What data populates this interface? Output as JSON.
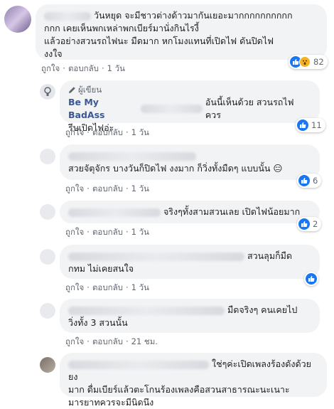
{
  "actions": {
    "like": "ถูกใจ",
    "dot": "·",
    "reply": "ตอบกลับ"
  },
  "comments": [
    {
      "text_lines": [
        "วันหยุด จะมีชาวต่างด้าวมากันเยอะมากกกกกกกกกก",
        "กกก เคยเห็นพกเหล่าพกเบียร์มานั่งกินไรงี้",
        "แล้วอย่างสวนรถไฟนะ มืดมาก หกโมงแทนที่เปิดไฟ ดันปิดไฟ",
        "งงใจ"
      ],
      "time": "1 วัน",
      "reaction_count": "82",
      "reactions": [
        "like-icon",
        "wow-icon"
      ]
    },
    {
      "author_tag": "ผู้เขียน",
      "author_name": "Be My BadAss",
      "text_lines": [
        "อันนี้เห็นด้วย สวนรถไฟ ควร",
        "รีบเปิดไฟอ่ะ"
      ],
      "time": "1 วัน",
      "reaction_count": "11",
      "reactions": [
        "like-icon"
      ]
    },
    {
      "text_lines": [
        "สวยจัตุจักร บางวันก็ปิดไฟ งงมาก ก็วิ่งทั้งมืดๆ แบบนั้น 😑"
      ],
      "time": "1 วัน",
      "reaction_count": "6",
      "reactions": [
        "like-icon"
      ]
    },
    {
      "text_lines": [
        "จริงๆทั้งสามสวนเลย เปิดไฟน้อยมาก"
      ],
      "time": "1 วัน",
      "reaction_count": "2",
      "reactions": [
        "like-icon"
      ]
    },
    {
      "text_lines": [
        "สวนลุมก็มืด",
        "กทม ไม่เคยสนใจ"
      ],
      "time": "1 วัน",
      "reaction_count": "",
      "reactions": [
        "like-icon"
      ]
    },
    {
      "text_lines": [
        "มืดจริงๆ คนเคยไป",
        "วิ่งทั้ง 3 สวนนั้น"
      ],
      "time": "21 ชม.",
      "reaction_count": "",
      "reactions": []
    },
    {
      "text_lines": [
        "ใช่ๆค่ะเปิดเพลงร้องดังด้วยยง",
        "มาก ดื่มเบียร์แล้วตะโกนร้องเพลงคือสวนสาธารณะนะเนาะ",
        "มารยาทควรจะมีนิดนึง"
      ],
      "time": "",
      "reaction_count": "",
      "reactions": []
    }
  ]
}
